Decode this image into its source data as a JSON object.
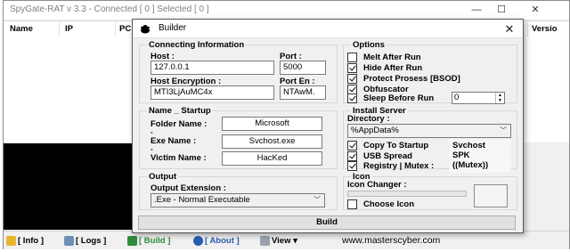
{
  "main_window": {
    "title": "SpyGate-RAT v 3.3 - Connected [ 0 ] Selected [ 0 ]",
    "caption": {
      "minimize": "—",
      "maximize": "☐",
      "close": "✕"
    },
    "columns": [
      "Name",
      "IP",
      "PC",
      "Versio"
    ],
    "statusbar": {
      "info": "[ Info ]",
      "logs": "[ Logs ]",
      "build": "[ Build ]",
      "about": "[ About ]",
      "view": "View ▾",
      "website": "www.masterscyber.com"
    }
  },
  "builder": {
    "title": "Builder",
    "connecting": {
      "title": "Connecting Information",
      "host_label": "Host :",
      "host_value": "127.0.0.1",
      "port_label": "Port :",
      "port_value": "5000",
      "encryption_label": "Host Encryption :",
      "encryption_value": "MTI3LjAuMC4x",
      "port_en_label": "Port En :",
      "port_en_value": "NTAwM."
    },
    "options": {
      "title": "Options",
      "items": [
        {
          "label": "Melt After Run",
          "checked": false
        },
        {
          "label": "Hide After Run",
          "checked": true
        },
        {
          "label": "Protect Prosess [BSOD]",
          "checked": true
        },
        {
          "label": "Obfuscator",
          "checked": true
        },
        {
          "label": "Sleep Before Run",
          "checked": true
        }
      ],
      "sleep_value": "0"
    },
    "name_startup": {
      "title": "Name _ Startup",
      "folder_label": "Folder Name :",
      "folder_value": "Microsoft",
      "exe_label": "Exe Name :",
      "exe_value": "Svchost.exe",
      "victim_label": "Victim Name :",
      "victim_value": "HacKed",
      "dash": "-"
    },
    "install": {
      "title": "Install Server",
      "directory_label": "Directory :",
      "directory_value": "%AppData%",
      "items": [
        {
          "label": "Copy To Startup",
          "checked": true,
          "value": "Svchost"
        },
        {
          "label": "USB Spread",
          "checked": true,
          "value": "SPK"
        },
        {
          "label": "Registry | Mutex :",
          "checked": true,
          "value": "((Mutex))"
        }
      ]
    },
    "output": {
      "title": "Output",
      "extension_label": "Output Extension :",
      "extension_value": ".Exe - Normal Executable"
    },
    "icon": {
      "title": "Icon",
      "changer_label": "Icon Changer :",
      "choose_label": "Choose Icon",
      "choose_checked": false
    },
    "build_button": "Build"
  },
  "colors": {
    "window_bg": "#f0f0f0",
    "log_area": "#000000",
    "accent_green": "#2e8b3a",
    "accent_blue": "#2a5db0"
  }
}
